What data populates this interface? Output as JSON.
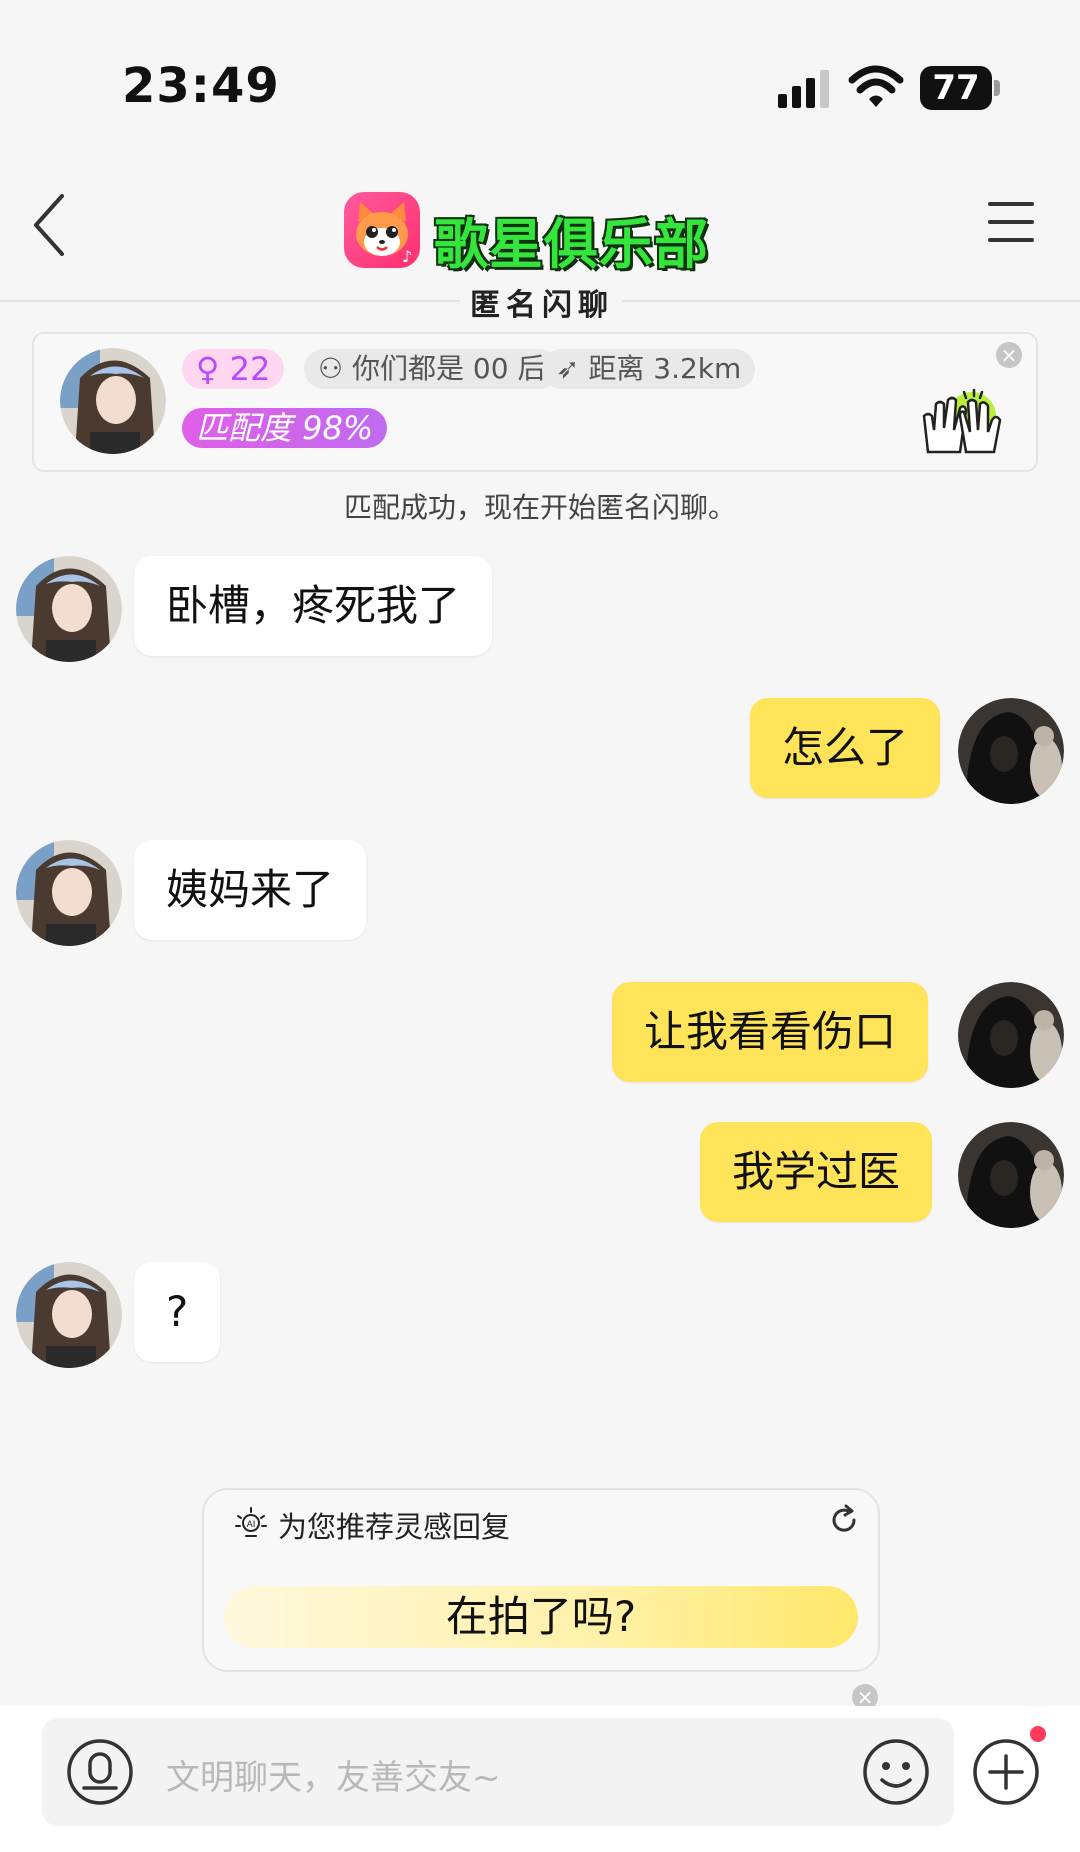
{
  "status_bar": {
    "time": "23:49",
    "battery": "77",
    "battery_level": 0.77,
    "icons": [
      "signal-icon",
      "wifi-icon",
      "battery-icon"
    ]
  },
  "header": {
    "app_name": "歌星俱乐部",
    "subtitle": "匿名闪聊",
    "icons": [
      "back-chevron-icon",
      "app-logo-icon",
      "menu-icon"
    ]
  },
  "match_card": {
    "age": "22",
    "generation": "你们都是 00 后",
    "distance": "距离 3.2km",
    "match_rate": "匹配度 98%",
    "icons": [
      "female-icon",
      "people-icon",
      "runner-icon",
      "high-five-icon",
      "close-icon"
    ]
  },
  "system_message": "匹配成功，现在开始匿名闪聊。",
  "messages": [
    {
      "side": "in",
      "text": "卧槽，疼死我了"
    },
    {
      "side": "out",
      "text": "怎么了"
    },
    {
      "side": "in",
      "text": "姨妈来了"
    },
    {
      "side": "out",
      "text": "让我看看伤口"
    },
    {
      "side": "out",
      "text": "我学过医"
    },
    {
      "side": "in",
      "text": "?"
    }
  ],
  "suggestion": {
    "title": "为您推荐灵感回复",
    "reply": "在拍了吗?",
    "icons": [
      "ai-bulb-icon",
      "refresh-icon",
      "close-icon"
    ]
  },
  "input_bar": {
    "placeholder": "文明聊天，友善交友~",
    "icons": [
      "voice-icon",
      "emoji-icon",
      "plus-icon"
    ]
  },
  "colors": {
    "outgoing_bubble": "#ffe45a",
    "incoming_bubble": "#ffffff",
    "brand_green": "#34e63c",
    "match_pink": "#ffd6ef",
    "badge_dot": "#ff3b5c"
  }
}
